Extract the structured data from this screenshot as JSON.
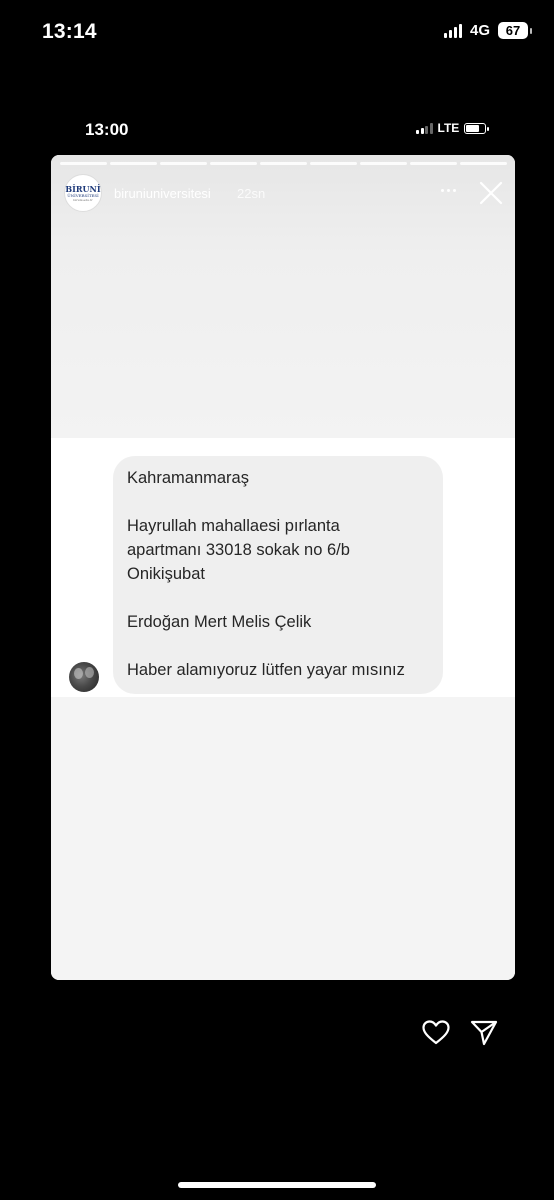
{
  "outer_status_bar": {
    "time": "13:14",
    "network": "4G",
    "battery": "67"
  },
  "inner_status_bar": {
    "time": "13:00",
    "network": "LTE"
  },
  "story": {
    "account_name": "biruniuniversitesi",
    "age": "22sn",
    "logo": {
      "line1": "BİRUNİ",
      "line2": "ÜNİVERSİTESİ",
      "line3": "biruni.edu.tr"
    },
    "progress_segments": 9
  },
  "message": {
    "lines": [
      "Kahramanmaraş",
      "",
      "Hayrullah mahallaesi pırlanta",
      "apartmanı 33018 sokak no 6/b",
      "Onikişubat",
      "",
      "Erdoğan Mert Melis Çelik",
      "",
      "Haber alamıyoruz lütfen yayar mısınız"
    ]
  },
  "icons": {
    "heart": "heart-icon",
    "send": "send-icon",
    "close": "close-icon",
    "more": "more-icon"
  }
}
